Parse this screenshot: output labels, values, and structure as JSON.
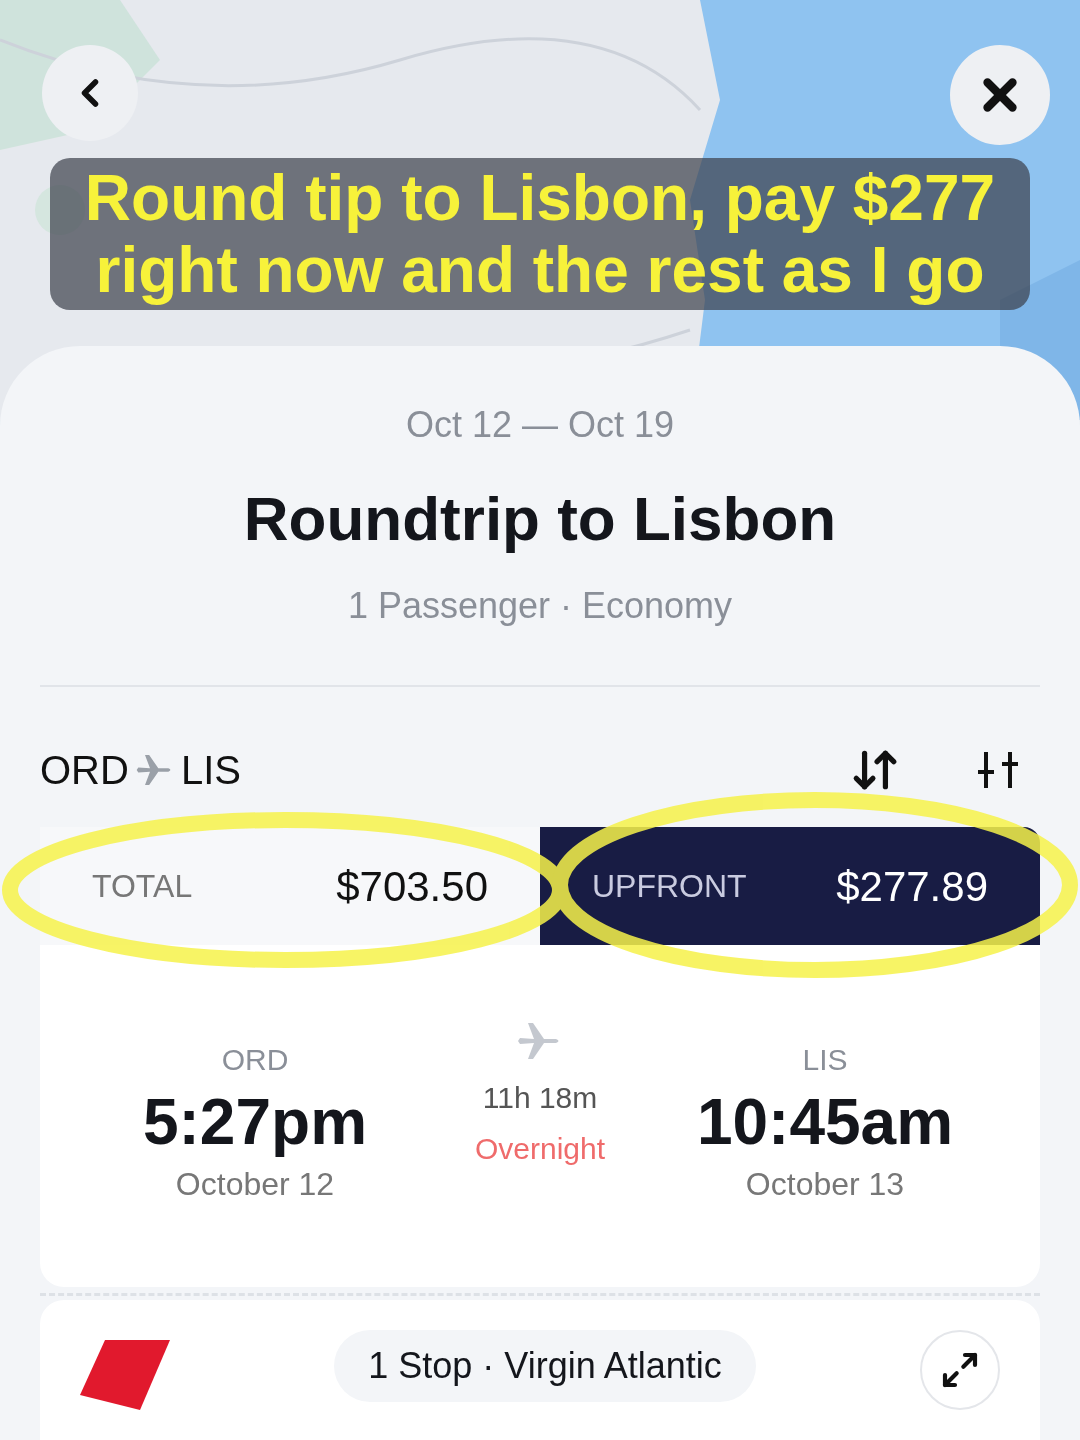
{
  "caption": "Round tip to Lisbon, pay $277 right now and the rest as I go",
  "trip": {
    "dates": "Oct 12 — Oct 19",
    "title": "Roundtrip to Lisbon",
    "details": "1 Passenger · Economy"
  },
  "route": {
    "origin": "ORD",
    "destination": "LIS"
  },
  "price_tabs": [
    {
      "label": "TOTAL",
      "amount": "$703.50",
      "selected": false
    },
    {
      "label": "UPFRONT",
      "amount": "$277.89",
      "selected": true
    }
  ],
  "flight": {
    "departure": {
      "airport": "ORD",
      "time": "5:27pm",
      "date": "October 12"
    },
    "duration": "11h 18m",
    "note": "Overnight",
    "arrival": {
      "airport": "LIS",
      "time": "10:45am",
      "date": "October 13"
    }
  },
  "itinerary": {
    "summary": "1 Stop · Virgin Atlantic"
  }
}
